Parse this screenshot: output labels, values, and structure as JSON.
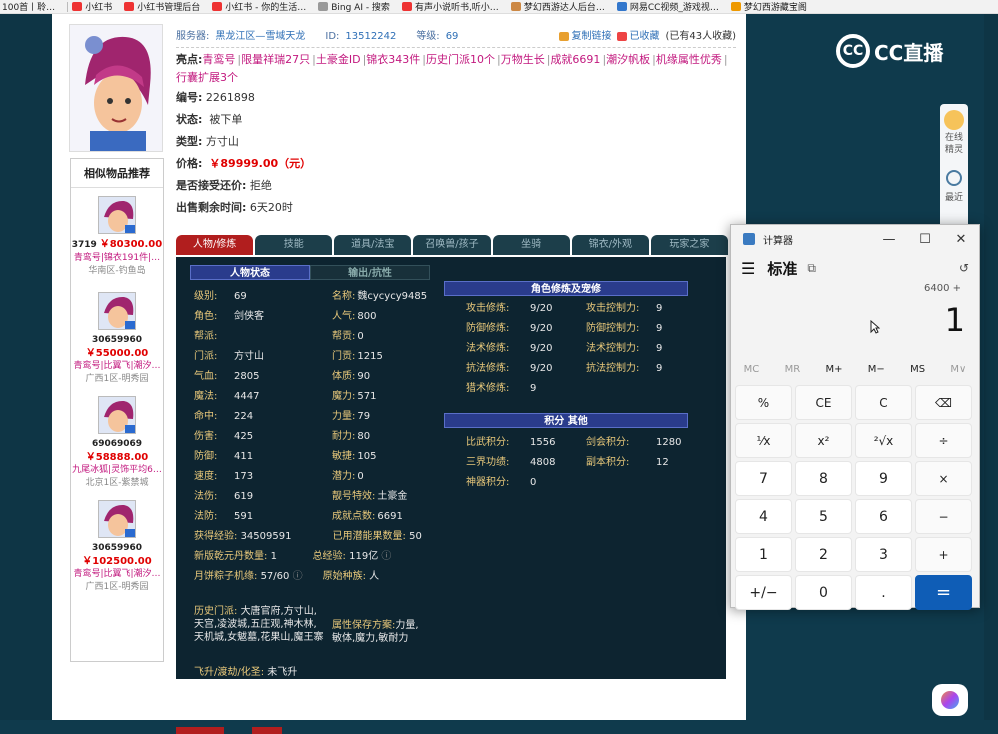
{
  "bookmarks": [
    "100首丨聆…",
    "小红书",
    "小红书管理后台",
    "小红书 - 你的生活…",
    "Bing AI - 搜索",
    "有声小说听书,听小…",
    "梦幻西游达人后台…",
    "网易CC视频_游戏视…",
    "梦幻西游藏宝阁"
  ],
  "header": {
    "server_label": "服务器:",
    "server": "黑龙江区—雪域天龙",
    "id_label": "ID:",
    "id": "13512242",
    "level_label": "等级:",
    "level": "69",
    "copy_link": "复制链接",
    "favorited": "已收藏",
    "fav_count": "(已有43人收藏)"
  },
  "highlights_label": "亮点:",
  "highlights": [
    "青鸾号",
    "限量祥瑞27只",
    "土豪金ID",
    "锦衣343件",
    "历史门派10个",
    "万物生长",
    "成就6691",
    "潮汐帆板",
    "机缘属性优秀",
    "行囊扩展3个"
  ],
  "fields": {
    "code_label": "编号:",
    "code": "2261898",
    "status_label": "状态:",
    "status": "被下单",
    "type_label": "类型:",
    "type": "方寸山",
    "price_label": "价格:",
    "price": "￥89999.00（元）",
    "bargain_label": "是否接受还价:",
    "bargain": "拒绝",
    "remaining_label": "出售剩余时间:",
    "remaining": "6天20时"
  },
  "sidebar": {
    "title": "相似物品推荐",
    "items": [
      {
        "id": "3719",
        "price": "￥80300.00",
        "tags": "青鸾号|锦衣191件|…",
        "server": "华南区-钓鱼岛"
      },
      {
        "id": "30659960",
        "price": "￥55000.00",
        "tags": "青鸾号|比翼飞|潮汐…",
        "server": "广西1区-明秀园"
      },
      {
        "id": "69069069",
        "price": "￥58888.00",
        "tags": "九尾冰狐|灵饰平均6…",
        "server": "北京1区-紫禁城"
      },
      {
        "id": "30659960",
        "price": "￥102500.00",
        "tags": "青鸾号|比翼飞|潮汐…",
        "server": "广西1区-明秀园"
      }
    ]
  },
  "tabs": [
    "人物/修炼",
    "技能",
    "道具/法宝",
    "召唤兽/孩子",
    "坐骑",
    "锦衣/外观",
    "玩家之家"
  ],
  "subtabs": [
    "人物状态",
    "输出/抗性"
  ],
  "stats_left": [
    [
      "级别:",
      "69"
    ],
    [
      "角色:",
      "剑侠客"
    ],
    [
      "帮派:",
      ""
    ],
    [
      "门派:",
      "方寸山"
    ],
    [
      "气血:",
      "2805"
    ],
    [
      "魔法:",
      "4447"
    ],
    [
      "命中:",
      "224"
    ],
    [
      "伤害:",
      "425"
    ],
    [
      "防御:",
      "411"
    ],
    [
      "速度:",
      "173"
    ],
    [
      "法伤:",
      "619"
    ],
    [
      "法防:",
      "591"
    ]
  ],
  "stats_right": [
    [
      "名称:",
      "魏cycycy9485"
    ],
    [
      "人气:",
      "800"
    ],
    [
      "帮贡:",
      "0"
    ],
    [
      "门贡:",
      "1215"
    ],
    [
      "体质:",
      "90"
    ],
    [
      "魔力:",
      "571"
    ],
    [
      "力量:",
      "79"
    ],
    [
      "耐力:",
      "80"
    ],
    [
      "敏捷:",
      "105"
    ],
    [
      "潜力:",
      "0"
    ],
    [
      "靓号特效:",
      "土豪金"
    ],
    [
      "成就点数:",
      "6691"
    ]
  ],
  "stats_wide": [
    [
      "获得经验:",
      "34509591",
      "已用潜能果数量:",
      "50"
    ],
    [
      "新版乾元丹数量:",
      "1",
      "总经验:",
      "119亿"
    ],
    [
      "月饼粽子机缘:",
      "57/60",
      "原始种族:",
      "人"
    ]
  ],
  "history_label": "历史门派:",
  "history": "大唐官府,方寸山,天宫,凌波城,五庄观,神木林,天机城,女魃墓,花果山,魔王寨",
  "attr_label": "属性保存方案:",
  "attr": "力量,敏体,魔力,敏耐力",
  "ascend_label": "飞升/渡劫/化圣:",
  "ascend": "未飞升",
  "cultivation_title": "角色修炼及宠修",
  "cultivation": [
    [
      "攻击修炼:",
      "9/20",
      "攻击控制力:",
      "9"
    ],
    [
      "防御修炼:",
      "9/20",
      "防御控制力:",
      "9"
    ],
    [
      "法术修炼:",
      "9/20",
      "法术控制力:",
      "9"
    ],
    [
      "抗法修炼:",
      "9/20",
      "抗法控制力:",
      "9"
    ],
    [
      "猎术修炼:",
      "9",
      "",
      ""
    ]
  ],
  "points_title": "积分 其他",
  "points": [
    [
      "比武积分:",
      "1556",
      "剑会积分:",
      "1280"
    ],
    [
      "三界功绩:",
      "4808",
      "副本积分:",
      "12"
    ],
    [
      "神器积分:",
      "0",
      "",
      ""
    ]
  ],
  "dock": {
    "online": "在线",
    "sprite": "精灵",
    "recent": "最近"
  },
  "logo": "CC直播",
  "calculator": {
    "title": "计算器",
    "mode": "标准",
    "expression": "6400 +",
    "display": "1",
    "memory": [
      "MC",
      "MR",
      "M+",
      "M−",
      "MS",
      "M∨"
    ],
    "keys": [
      "%",
      "CE",
      "C",
      "⌫",
      "⅟x",
      "x²",
      "²√x",
      "÷",
      "7",
      "8",
      "9",
      "×",
      "4",
      "5",
      "6",
      "−",
      "1",
      "2",
      "3",
      "+",
      "+/−",
      "0",
      ".",
      "="
    ]
  }
}
